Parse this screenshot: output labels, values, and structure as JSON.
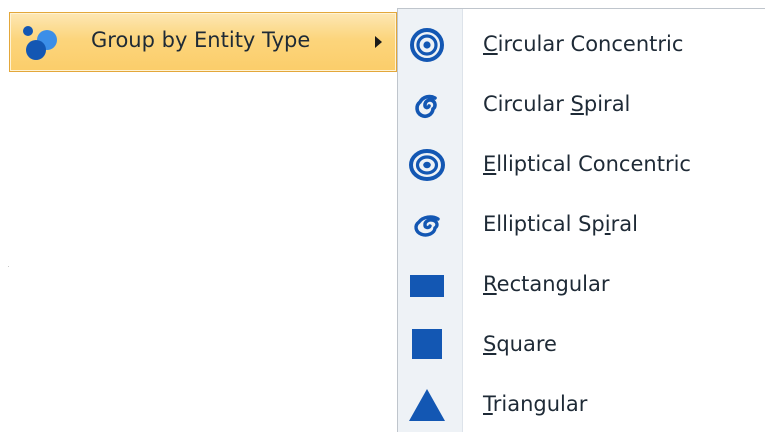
{
  "parent_item": {
    "label": "Group by Entity Type",
    "icon": "group-bubbles-icon",
    "has_submenu": true
  },
  "submenu": {
    "items": [
      {
        "label_pre": "",
        "mnemonic": "C",
        "label_post": "ircular Concentric",
        "icon": "concentric-circles-icon"
      },
      {
        "label_pre": "Circular ",
        "mnemonic": "S",
        "label_post": "piral",
        "icon": "spiral-icon"
      },
      {
        "label_pre": "",
        "mnemonic": "E",
        "label_post": "lliptical Concentric",
        "icon": "elliptical-concentric-icon"
      },
      {
        "label_pre": "Elliptical Sp",
        "mnemonic": "i",
        "label_post": "ral",
        "icon": "elliptical-spiral-icon"
      },
      {
        "label_pre": "",
        "mnemonic": "R",
        "label_post": "ectangular",
        "icon": "rectangle-icon"
      },
      {
        "label_pre": "",
        "mnemonic": "S",
        "label_post": "quare",
        "icon": "square-icon"
      },
      {
        "label_pre": "",
        "mnemonic": "T",
        "label_post": "riangular",
        "icon": "triangle-icon"
      }
    ]
  },
  "colors": {
    "icon_blue": "#1357b3",
    "highlight_gradient_top": "#fde7b4",
    "highlight_gradient_bottom": "#fbcd6a",
    "highlight_border": "#e3a73a",
    "gutter": "#eef2f6",
    "text": "#1e2a36"
  }
}
